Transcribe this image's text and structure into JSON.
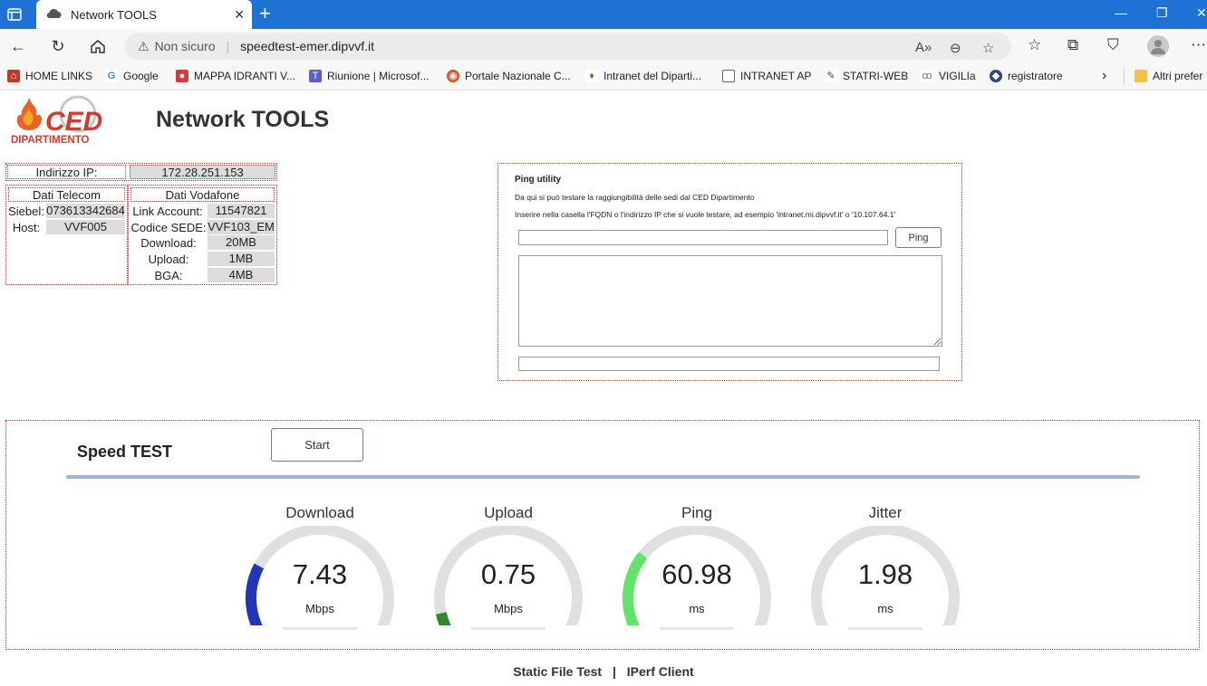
{
  "browser": {
    "tab_title": "Network TOOLS",
    "url_warning": "Non sicuro",
    "url": "speedtest-emer.dipvvf.it",
    "bookmarks": [
      {
        "label": "HOME LINKS",
        "color": "#c0392b"
      },
      {
        "label": "Google",
        "color": "#4285f4"
      },
      {
        "label": "MAPPA IDRANTI V...",
        "color": "#d63a3a"
      },
      {
        "label": "Riunione | Microsof...",
        "color": "#5b5fc7"
      },
      {
        "label": "Portale Nazionale C...",
        "color": "#d9541e"
      },
      {
        "label": "Intranet del Diparti...",
        "color": "#8a6d1f"
      },
      {
        "label": "INTRANET AP",
        "color": "#888888"
      },
      {
        "label": "STATRI-WEB",
        "color": "#444444"
      },
      {
        "label": "VIGILIa",
        "color": "#5a8c3a"
      },
      {
        "label": "registratore",
        "color": "#2b4a7a"
      }
    ],
    "other_favorites": "Altri prefer"
  },
  "page": {
    "title": "Network TOOLS",
    "logo_text_top": "CED",
    "logo_text_bottom": "DIPARTIMENTO"
  },
  "ip": {
    "label": "Indirizzo IP:",
    "value": "172.28.251.153"
  },
  "telecom": {
    "header": "Dati Telecom",
    "siebel_label": "Siebel:",
    "siebel_value": "073613342684",
    "host_label": "Host:",
    "host_value": "VVF005"
  },
  "vodafone": {
    "header": "Dati Vodafone",
    "rows": [
      {
        "label": "Link Account:",
        "value": "11547821"
      },
      {
        "label": "Codice SEDE:",
        "value": "VVF103_EM"
      },
      {
        "label": "Download:",
        "value": "20MB"
      },
      {
        "label": "Upload:",
        "value": "1MB"
      },
      {
        "label": "BGA:",
        "value": "4MB"
      }
    ]
  },
  "ping": {
    "title": "Ping utility",
    "line1": "Da qui si può testare la raggiungibilità delle sedi dal CED Dipartimento",
    "line2": "Inserire nella casella l'FQDN o l'indirizzo IP che si vuole testare, ad esempio 'intranet.mi.dipvvf.it' o '10.107.64.1'",
    "button": "Ping",
    "input_value": "",
    "output_value": "",
    "result_value": ""
  },
  "speedtest": {
    "title": "Speed TEST",
    "start_label": "Start",
    "progress_color": "#9ab6d8",
    "gauges": [
      {
        "label": "Download",
        "value": "7.43",
        "unit": "Mbps",
        "fraction": 0.27,
        "color": "#2035b8"
      },
      {
        "label": "Upload",
        "value": "0.75",
        "unit": "Mbps",
        "fraction": 0.12,
        "color": "#2f8a2f"
      },
      {
        "label": "Ping",
        "value": "60.98",
        "unit": "ms",
        "fraction": 0.31,
        "color": "#62e36a"
      },
      {
        "label": "Jitter",
        "value": "1.98",
        "unit": "ms",
        "fraction": 0.06,
        "color": "#62e36a"
      }
    ]
  },
  "footer": {
    "static_file": "Static File Test",
    "separator": "|",
    "iperf": "IPerf Client"
  }
}
